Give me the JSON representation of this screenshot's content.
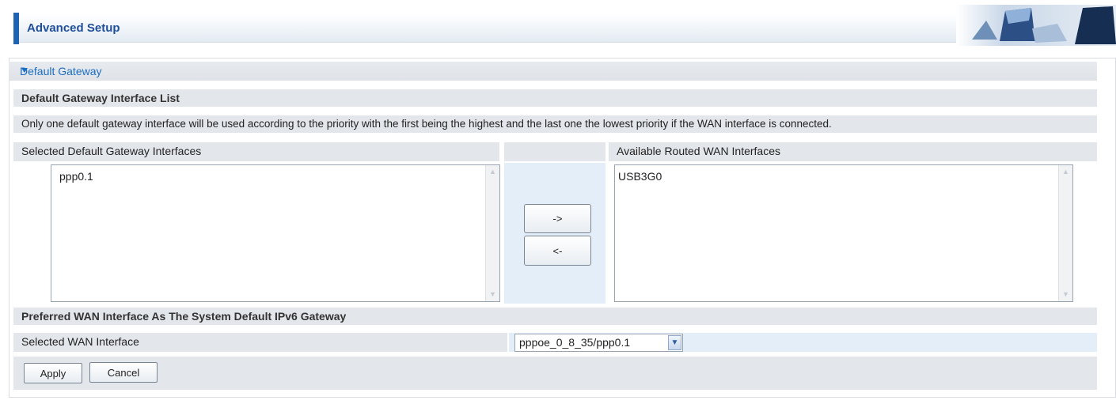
{
  "header": {
    "title": "Advanced Setup"
  },
  "section": {
    "title": "Default Gateway"
  },
  "gateway_list": {
    "heading": "Default Gateway Interface List",
    "description": "Only one default gateway interface will be used according to the priority with the first being the highest and the last one the lowest priority if the WAN interface is connected.",
    "selected_label": "Selected Default Gateway Interfaces",
    "available_label": "Available Routed WAN Interfaces",
    "selected_items": [
      "ppp0.1"
    ],
    "available_items": [
      "USB3G0"
    ],
    "move_right_label": "->",
    "move_left_label": "<-"
  },
  "ipv6": {
    "heading": "Preferred WAN Interface As The System Default IPv6 Gateway",
    "field_label": "Selected WAN Interface",
    "selected_value": "pppoe_0_8_35/ppp0.1"
  },
  "actions": {
    "apply_label": "Apply",
    "cancel_label": "Cancel"
  },
  "colors": {
    "accent": "#1f63b3",
    "section_title": "#1d6ec2",
    "row_bg": "#e3e6ea"
  },
  "icons": {
    "section_toggle": "triangle-down-icon",
    "select_arrow": "chevron-down-icon",
    "scroll_up": "scroll-up-arrow-icon",
    "scroll_down": "scroll-down-arrow-icon"
  }
}
